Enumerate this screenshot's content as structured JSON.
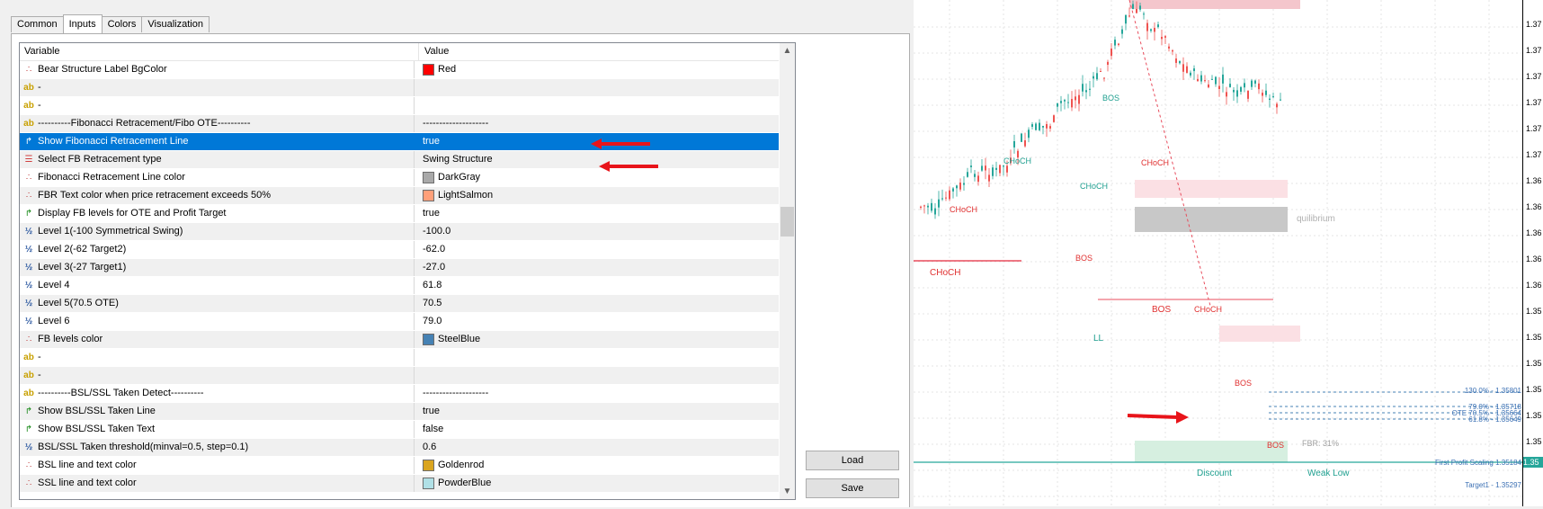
{
  "tabs": [
    "Common",
    "Inputs",
    "Colors",
    "Visualization"
  ],
  "grid": {
    "col_variable": "Variable",
    "col_value": "Value",
    "rows": [
      {
        "icon": "color",
        "label": "Bear Structure Label BgColor",
        "value": "Red",
        "swatch": "#ff0000"
      },
      {
        "icon": "ab",
        "label": "-",
        "value": ""
      },
      {
        "icon": "ab",
        "label": "-",
        "value": ""
      },
      {
        "icon": "ab",
        "label": "----------Fibonacci Retracement/Fibo OTE----------",
        "value": "--------------------"
      },
      {
        "icon": "flag",
        "label": "Show Fibonacci Retracement Line",
        "value": "true",
        "selected": true
      },
      {
        "icon": "list",
        "label": "Select FB Retracement type",
        "value": "Swing Structure"
      },
      {
        "icon": "color",
        "label": "Fibonacci Retracement Line color",
        "value": "DarkGray",
        "swatch": "#a9a9a9"
      },
      {
        "icon": "color",
        "label": "FBR Text color when price retracement exceeds 50%",
        "value": "LightSalmon",
        "swatch": "#ffa07a"
      },
      {
        "icon": "flag",
        "label": "Display FB levels for OTE and Profit Target",
        "value": "true"
      },
      {
        "icon": "half",
        "label": "Level 1(-100 Symmetrical Swing)",
        "value": "-100.0"
      },
      {
        "icon": "half",
        "label": "Level 2(-62 Target2)",
        "value": "-62.0"
      },
      {
        "icon": "half",
        "label": "Level 3(-27 Target1)",
        "value": "-27.0"
      },
      {
        "icon": "half",
        "label": "Level 4",
        "value": "61.8"
      },
      {
        "icon": "half",
        "label": "Level 5(70.5 OTE)",
        "value": "70.5"
      },
      {
        "icon": "half",
        "label": "Level 6",
        "value": "79.0"
      },
      {
        "icon": "color",
        "label": "FB levels color",
        "value": "SteelBlue",
        "swatch": "#4682b4"
      },
      {
        "icon": "ab",
        "label": "-",
        "value": ""
      },
      {
        "icon": "ab",
        "label": "-",
        "value": ""
      },
      {
        "icon": "ab",
        "label": "----------BSL/SSL Taken Detect----------",
        "value": "--------------------"
      },
      {
        "icon": "flag",
        "label": "Show BSL/SSL Taken Line",
        "value": "true"
      },
      {
        "icon": "flag",
        "label": "Show BSL/SSL Taken Text",
        "value": "false"
      },
      {
        "icon": "half",
        "label": "BSL/SSL Taken threshold(minval=0.5, step=0.1)",
        "value": "0.6"
      },
      {
        "icon": "color",
        "label": "BSL line and text color",
        "value": "Goldenrod",
        "swatch": "#daa520"
      },
      {
        "icon": "color",
        "label": "SSL line and text color",
        "value": "PowderBlue",
        "swatch": "#b0e0e6"
      }
    ]
  },
  "buttons": {
    "load": "Load",
    "save": "Save"
  },
  "chart": {
    "price_labels": [
      "1.37",
      "1.37",
      "1.37",
      "1.37",
      "1.37",
      "1.37",
      "1.36",
      "1.36",
      "1.36",
      "1.36",
      "1.36",
      "1.35",
      "1.35",
      "1.35",
      "1.35",
      "1.35",
      "1.35"
    ],
    "fibo_labels": [
      "130.0% - 1.35801",
      "79.0% - 1.35718",
      "OTE 70.5% - 1.35664",
      "61.8% - 1.35649",
      "First Profit Scaling 1.35184",
      "Target1 - 1.35297"
    ],
    "texts": {
      "choch_main": "CHoCH",
      "bos_main": "BOS",
      "ll": "LL",
      "discount": "Discount",
      "weak_low": "Weak Low",
      "equilibrium": "quilibrium",
      "fbr": "FBR: 31%",
      "choch_small": "CHoCH",
      "bos_small": "BOS",
      "price_marker": "1.35"
    }
  }
}
